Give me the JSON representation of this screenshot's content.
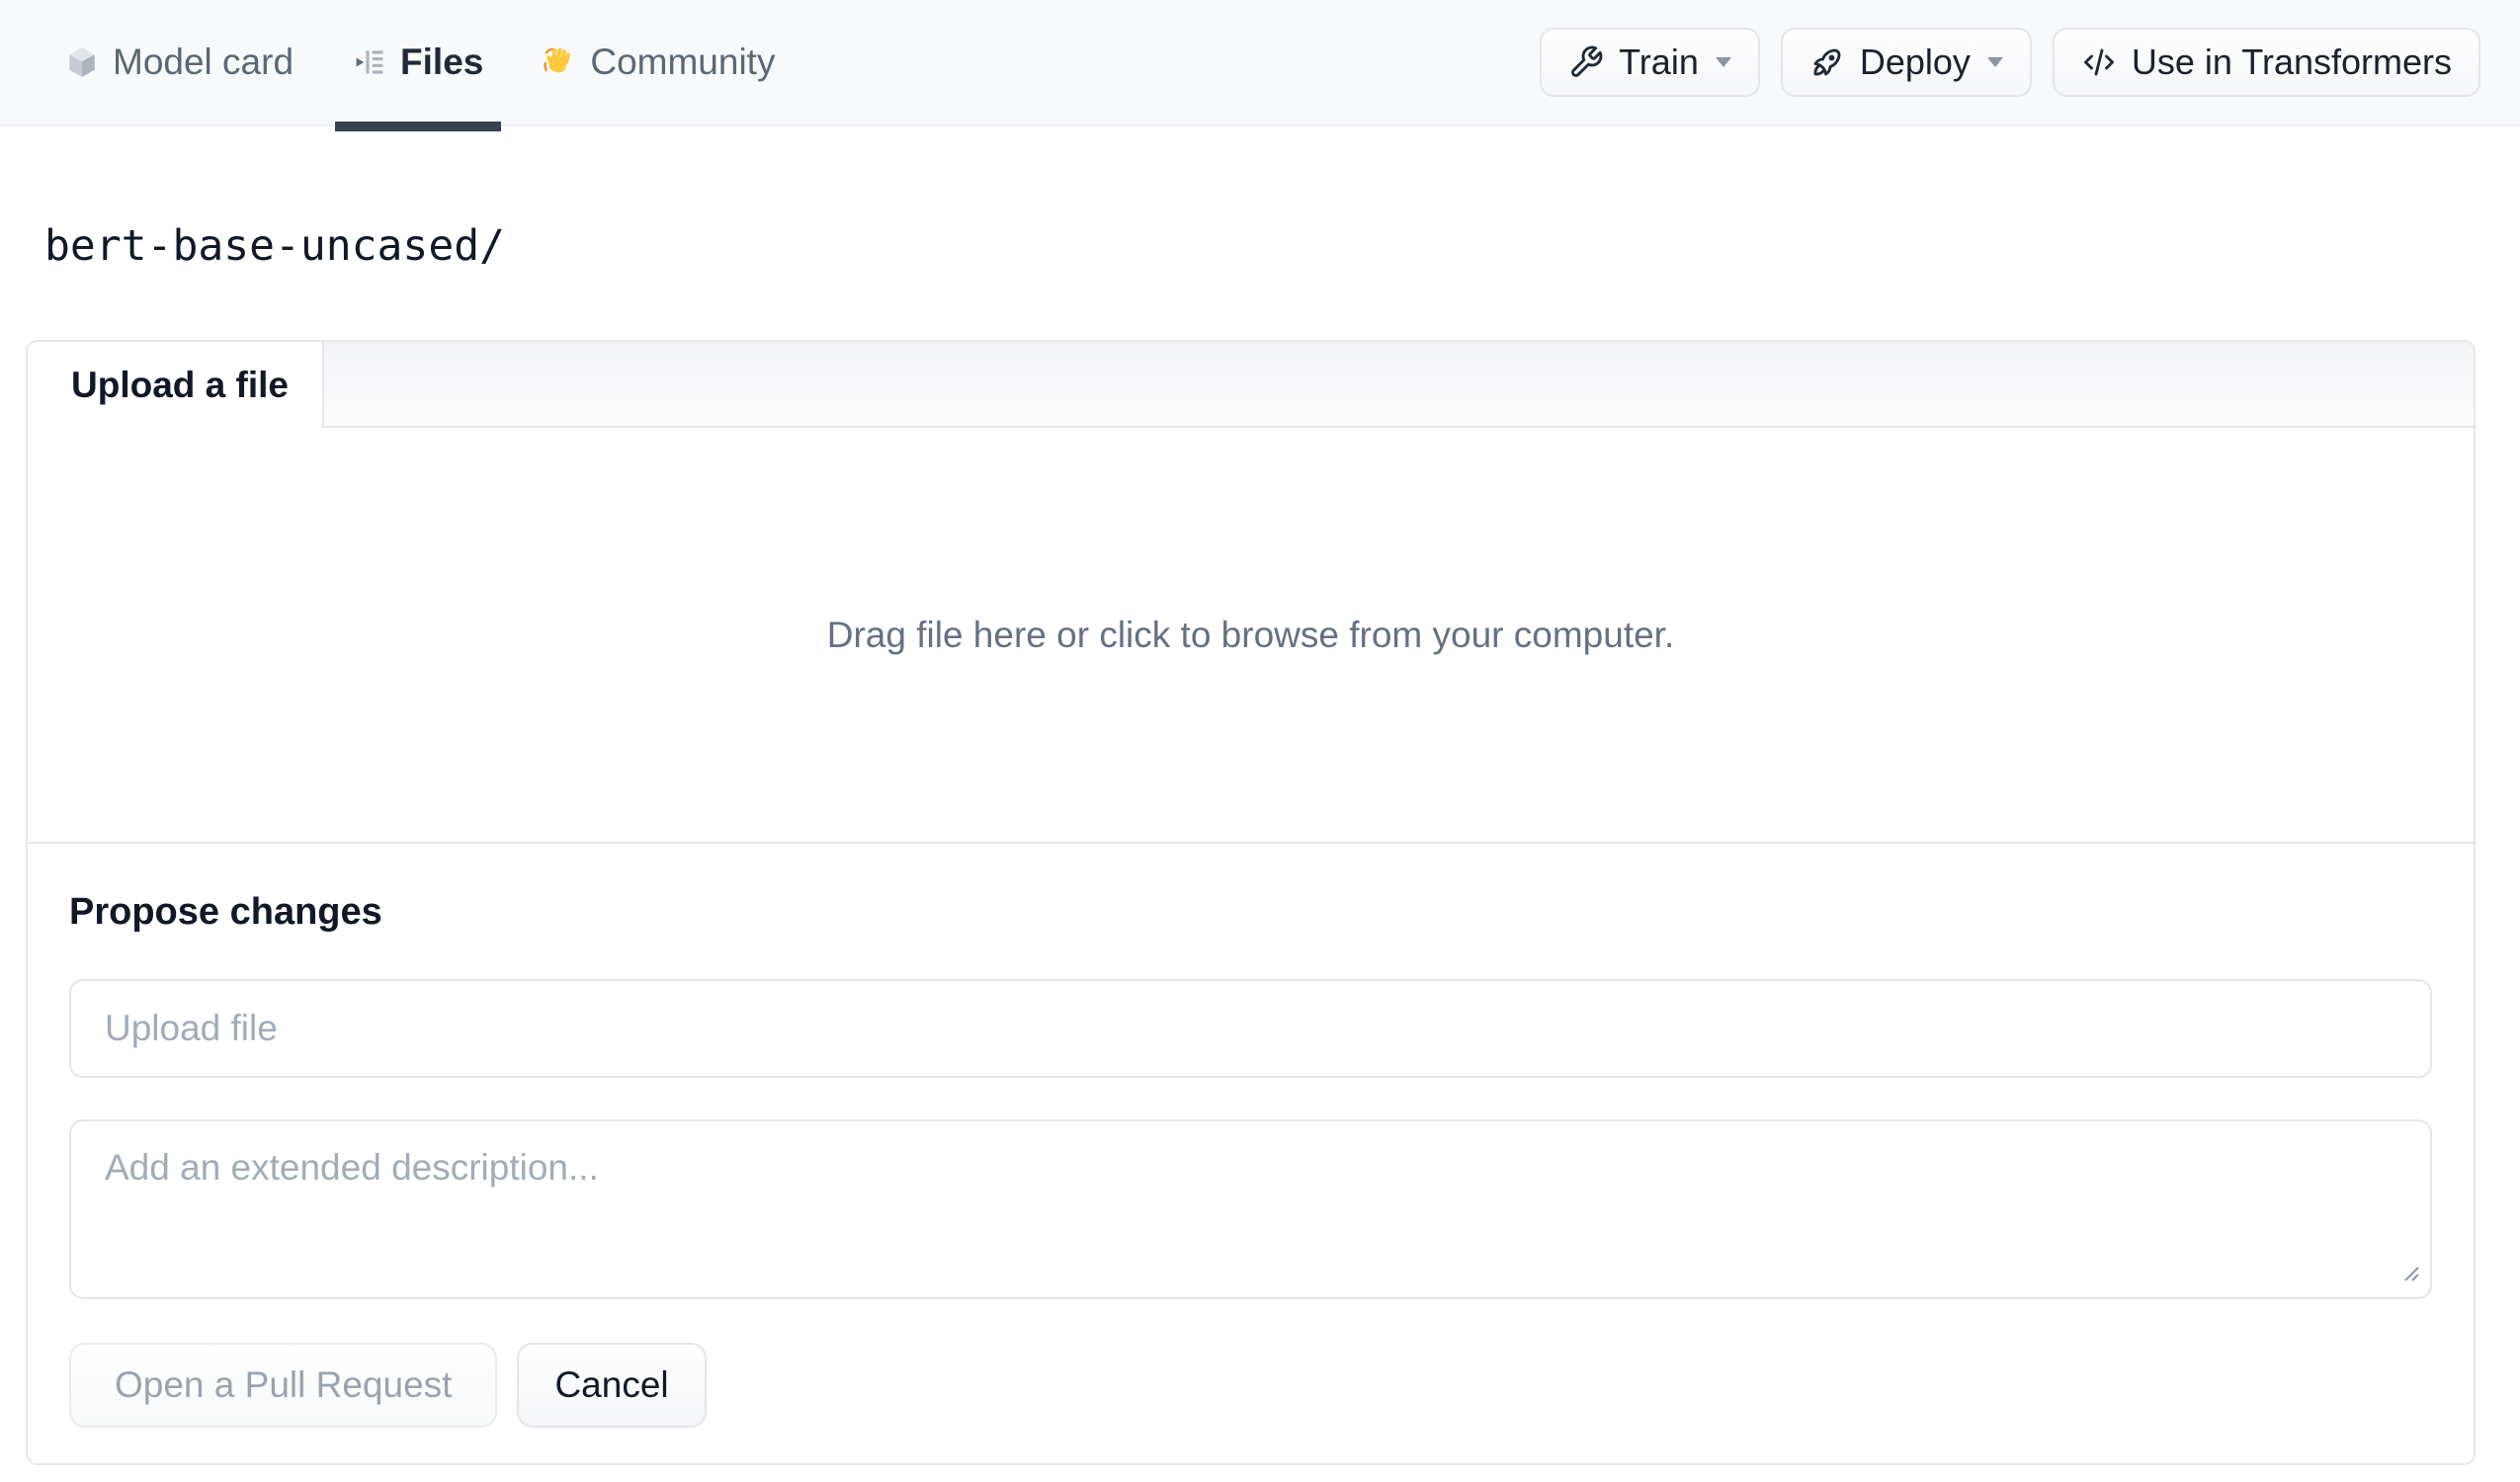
{
  "nav": {
    "tabs": [
      {
        "label": "Model card",
        "icon": "cube-icon",
        "active": false
      },
      {
        "label": "Files",
        "icon": "files-versions-icon",
        "active": true
      },
      {
        "label": "Community",
        "icon": "waving-hand-icon",
        "active": false
      }
    ],
    "actions": [
      {
        "label": "Train",
        "icon": "wrench-icon",
        "has_caret": true
      },
      {
        "label": "Deploy",
        "icon": "rocket-icon",
        "has_caret": true
      },
      {
        "label": "Use in Transformers",
        "icon": "code-icon",
        "has_caret": false
      }
    ]
  },
  "breadcrumb": {
    "path": "bert-base-uncased/"
  },
  "upload_panel": {
    "tab_label": "Upload a file",
    "dropzone_text": "Drag file here or click to browse from your computer.",
    "propose": {
      "heading": "Propose changes",
      "file_input_placeholder": "Upload file",
      "description_placeholder": "Add an extended description...",
      "submit_label": "Open a Pull Request",
      "cancel_label": "Cancel"
    }
  },
  "colors": {
    "header_bg": "#f8f9fb",
    "active_tab_underline": "#364152",
    "panel_border": "#e5e7eb",
    "muted_text": "#667083",
    "placeholder_text": "#a3abb8",
    "disabled_button_text": "#9aa2b1",
    "hand_emoji_fill": "#FFC83D",
    "hand_emoji_accent": "#F4900C"
  }
}
